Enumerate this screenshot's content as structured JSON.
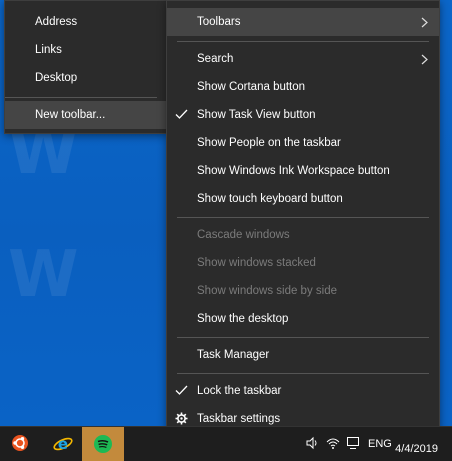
{
  "desktop": {
    "watermark_text": "W"
  },
  "toolbars_submenu": {
    "items": [
      {
        "label": "Address"
      },
      {
        "label": "Links"
      },
      {
        "label": "Desktop"
      },
      {
        "label": "New toolbar..."
      }
    ]
  },
  "context_menu": {
    "items": [
      {
        "label": "Toolbars",
        "has_submenu": true
      },
      {
        "label": "Search",
        "has_submenu": true
      },
      {
        "label": "Show Cortana button"
      },
      {
        "label": "Show Task View button",
        "checked": true
      },
      {
        "label": "Show People on the taskbar"
      },
      {
        "label": "Show Windows Ink Workspace button"
      },
      {
        "label": "Show touch keyboard button"
      },
      {
        "label": "Cascade windows",
        "disabled": true
      },
      {
        "label": "Show windows stacked",
        "disabled": true
      },
      {
        "label": "Show windows side by side",
        "disabled": true
      },
      {
        "label": "Show the desktop"
      },
      {
        "label": "Task Manager"
      },
      {
        "label": "Lock the taskbar",
        "checked": true
      },
      {
        "label": "Taskbar settings",
        "icon": "gear-icon"
      }
    ]
  },
  "taskbar": {
    "pinned_apps": [
      {
        "name": "ubuntu-icon"
      },
      {
        "name": "internet-explorer-icon"
      },
      {
        "name": "spotify-icon",
        "active": true
      }
    ],
    "tray": {
      "language": "ENG",
      "date": "4/4/2019"
    }
  },
  "colors": {
    "menu_bg": "#2b2b2b",
    "menu_hover": "#454545",
    "desktop_blue": "#0a63c5",
    "taskbar_bg": "#1e1e1e",
    "active_app": "#c38a3c"
  }
}
